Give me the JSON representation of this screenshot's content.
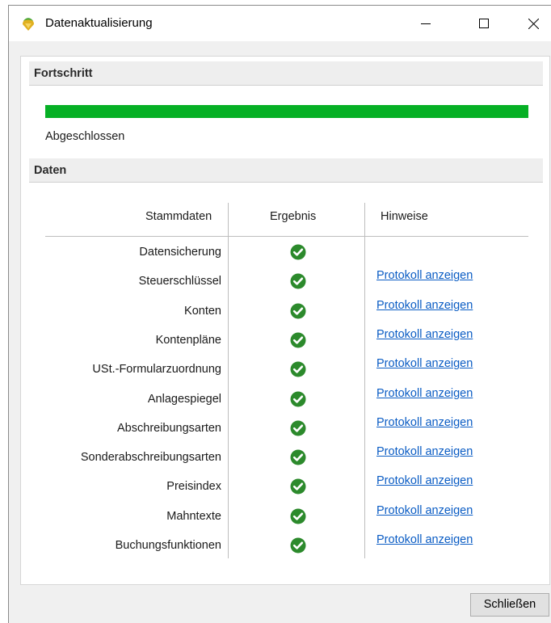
{
  "window": {
    "title": "Datenaktualisierung",
    "controls": [
      "minimize-icon",
      "maximize-icon",
      "close-icon"
    ]
  },
  "progress_section": {
    "header": "Fortschritt",
    "progress_fraction": 1.0,
    "bar_color": "#06b025",
    "status": "Abgeschlossen"
  },
  "data_section": {
    "header": "Daten",
    "columns": [
      "Stammdaten",
      "Ergebnis",
      "Hinweise"
    ],
    "rows": [
      {
        "name": "Datensicherung",
        "result": "check-icon",
        "note": ""
      },
      {
        "name": "Steuerschlüssel",
        "result": "check-icon",
        "note": "Protokoll anzeigen"
      },
      {
        "name": "Konten",
        "result": "check-icon",
        "note": "Protokoll anzeigen"
      },
      {
        "name": "Kontenpläne",
        "result": "check-icon",
        "note": "Protokoll anzeigen"
      },
      {
        "name": "USt.-Formularzuordnung",
        "result": "check-icon",
        "note": "Protokoll anzeigen"
      },
      {
        "name": "Anlagespiegel",
        "result": "check-icon",
        "note": "Protokoll anzeigen"
      },
      {
        "name": "Abschreibungsarten",
        "result": "check-icon",
        "note": "Protokoll anzeigen"
      },
      {
        "name": "Sonderabschreibungsarten",
        "result": "check-icon",
        "note": "Protokoll anzeigen"
      },
      {
        "name": "Preisindex",
        "result": "check-icon",
        "note": "Protokoll anzeigen"
      },
      {
        "name": "Mahntexte",
        "result": "check-icon",
        "note": "Protokoll anzeigen"
      },
      {
        "name": "Buchungsfunktionen",
        "result": "check-icon",
        "note": "Protokoll anzeigen"
      }
    ],
    "check_color": "#2c8a2c",
    "link_color": "#0a5cc4"
  },
  "footer": {
    "close_label": "Schließen"
  }
}
